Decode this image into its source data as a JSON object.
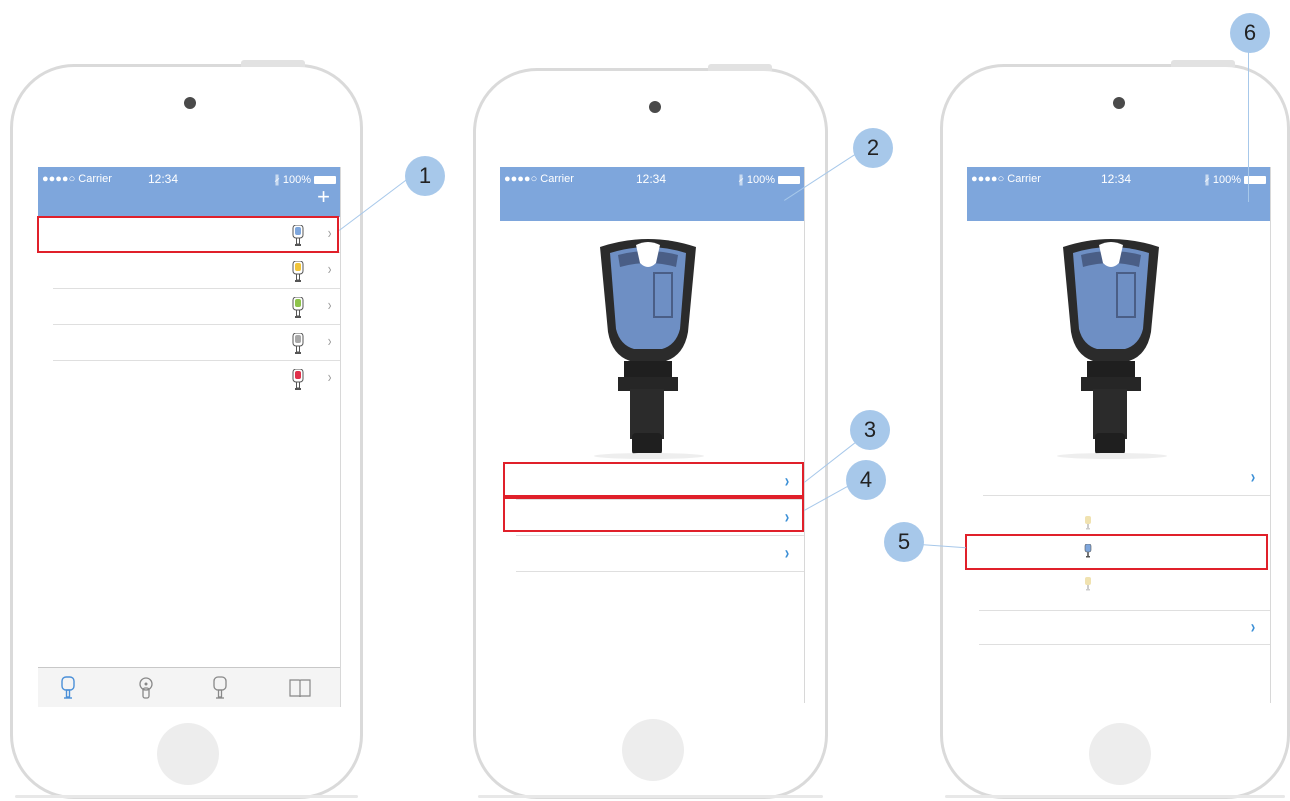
{
  "status_bar": {
    "carrier": "●●●●○ Carrier",
    "time": "12:34",
    "battery": "∦ 100%"
  },
  "screen1": {
    "add_label": "+",
    "key_colors": [
      "#7ea6dc",
      "#f0c43a",
      "#8dc34a",
      "#a8a8a8",
      "#e0304a"
    ],
    "chevron": "›",
    "tabs": [
      "key-icon",
      "cylinder-icon",
      "key-outline-icon",
      "book-icon"
    ]
  },
  "screen2": {
    "chevron": "›"
  },
  "screen3": {
    "chevron": "›",
    "small_key_colors": [
      "#f0e2b0",
      "#7ea6dc",
      "#f0e2b0"
    ]
  },
  "callouts": [
    "1",
    "2",
    "3",
    "4",
    "5",
    "6"
  ],
  "colors": {
    "accent": "#7ea6dc",
    "highlight": "#e0202a",
    "callout": "#a7c8ea",
    "chevron_blue": "#3b8fd6"
  }
}
